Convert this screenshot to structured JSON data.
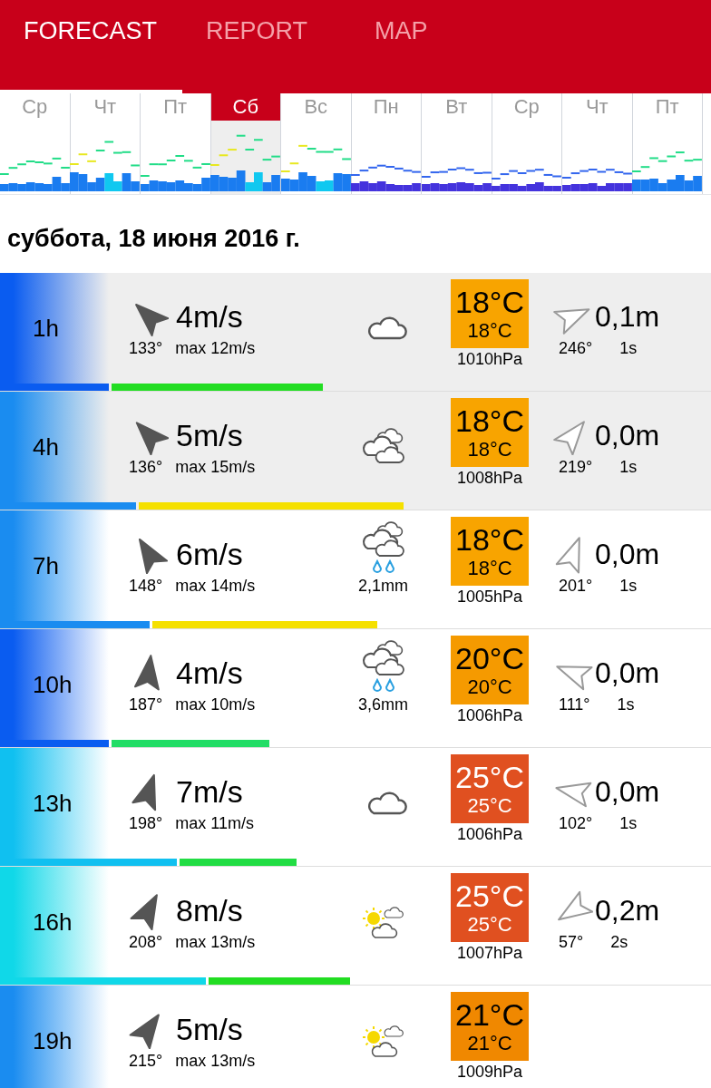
{
  "tabs": [
    {
      "label": "FORECAST",
      "selected": true
    },
    {
      "label": "REPORT",
      "selected": false
    },
    {
      "label": "MAP",
      "selected": false
    }
  ],
  "days": [
    {
      "label": "Ср",
      "selected": false
    },
    {
      "label": "Чт",
      "selected": false
    },
    {
      "label": "Пт",
      "selected": false
    },
    {
      "label": "Сб",
      "selected": true
    },
    {
      "label": "Вс",
      "selected": false
    },
    {
      "label": "Пн",
      "selected": false
    },
    {
      "label": "Вт",
      "selected": false
    },
    {
      "label": "Ср",
      "selected": false
    },
    {
      "label": "Чт",
      "selected": false
    },
    {
      "label": "Пт",
      "selected": false
    }
  ],
  "date": "суббота, 18 июня 2016 г.",
  "rows": [
    {
      "hour": "1h",
      "shaded": true,
      "color": "#0a5cf0",
      "wind": "4m/s",
      "wind_dir": "133°",
      "gust": "max 12m/s",
      "wind_bar": {
        "level": 0.153
      },
      "gust_bar": {
        "color": "#22dd22"
      },
      "weather": {
        "kind": "cloud"
      },
      "temperature": {
        "value": "18°C",
        "feels": "18°C",
        "color": "#f8a400"
      },
      "pressure": "1010hPa",
      "wave": "0,1m",
      "wave_dir": "246°",
      "period": "1s"
    },
    {
      "hour": "4h",
      "shaded": true,
      "color": "#1a8cf0",
      "wind": "5m/s",
      "wind_dir": "136°",
      "gust": "max 15m/s",
      "wind_bar": {
        "level": 0.191
      },
      "gust_bar": {
        "color": "#f5e000"
      },
      "weather": {
        "kind": "clouds"
      },
      "temperature": {
        "value": "18°C",
        "feels": "18°C",
        "color": "#f8a400"
      },
      "pressure": "1008hPa",
      "wave": "0,0m",
      "wave_dir": "219°",
      "period": "1s"
    },
    {
      "hour": "7h",
      "shaded": false,
      "color": "#1a8cf0",
      "wind": "6m/s",
      "wind_dir": "148°",
      "gust": "max 14m/s",
      "wind_bar": {
        "level": 0.21
      },
      "gust_bar": {
        "color": "#f5e000"
      },
      "weather": {
        "kind": "clouds_rain"
      },
      "precip": "2,1mm",
      "temperature": {
        "value": "18°C",
        "feels": "18°C",
        "color": "#f8a400"
      },
      "pressure": "1005hPa",
      "wave": "0,0m",
      "wave_dir": "201°",
      "period": "1s"
    },
    {
      "hour": "10h",
      "shaded": false,
      "color": "#0a5cf0",
      "wind": "4m/s",
      "wind_dir": "187°",
      "gust": "max 10m/s",
      "wind_bar": {
        "level": 0.153
      },
      "gust_bar": {
        "color": "#22dd66"
      },
      "weather": {
        "kind": "clouds_rain"
      },
      "precip": "3,6mm",
      "temperature": {
        "value": "20°C",
        "feels": "20°C",
        "color": "#f59a00"
      },
      "pressure": "1006hPa",
      "wave": "0,0m",
      "wave_dir": "111°",
      "period": "1s"
    },
    {
      "hour": "13h",
      "shaded": false,
      "color": "#10c0f0",
      "wind": "7m/s",
      "wind_dir": "198°",
      "gust": "max 11m/s",
      "wind_bar": {
        "level": 0.249
      },
      "gust_bar": {
        "color": "#22dd44"
      },
      "weather": {
        "kind": "cloud"
      },
      "temperature": {
        "value": "25°C",
        "feels": "25°C",
        "color": "#e05020"
      },
      "pressure": "1006hPa",
      "wave": "0,0m",
      "wave_dir": "102°",
      "period": "1s"
    },
    {
      "hour": "16h",
      "shaded": false,
      "color": "#10d8e8",
      "wind": "8m/s",
      "wind_dir": "208°",
      "gust": "max 13m/s",
      "wind_bar": {
        "level": 0.29
      },
      "gust_bar": {
        "color": "#22dd22"
      },
      "weather": {
        "kind": "sun_clouds"
      },
      "temperature": {
        "value": "25°C",
        "feels": "25°C",
        "color": "#e05020"
      },
      "pressure": "1007hPa",
      "wave": "0,2m",
      "wave_dir": "57°",
      "period": "2s"
    },
    {
      "hour": "19h",
      "shaded": false,
      "color": "#1a8cf0",
      "wind": "5m/s",
      "wind_dir": "215°",
      "gust": "max 13m/s",
      "weather": {
        "kind": "sun_clouds"
      },
      "temperature": {
        "value": "21°C",
        "feels": "21°C",
        "color": "#f08800"
      },
      "pressure": "1009hPa"
    }
  ]
}
